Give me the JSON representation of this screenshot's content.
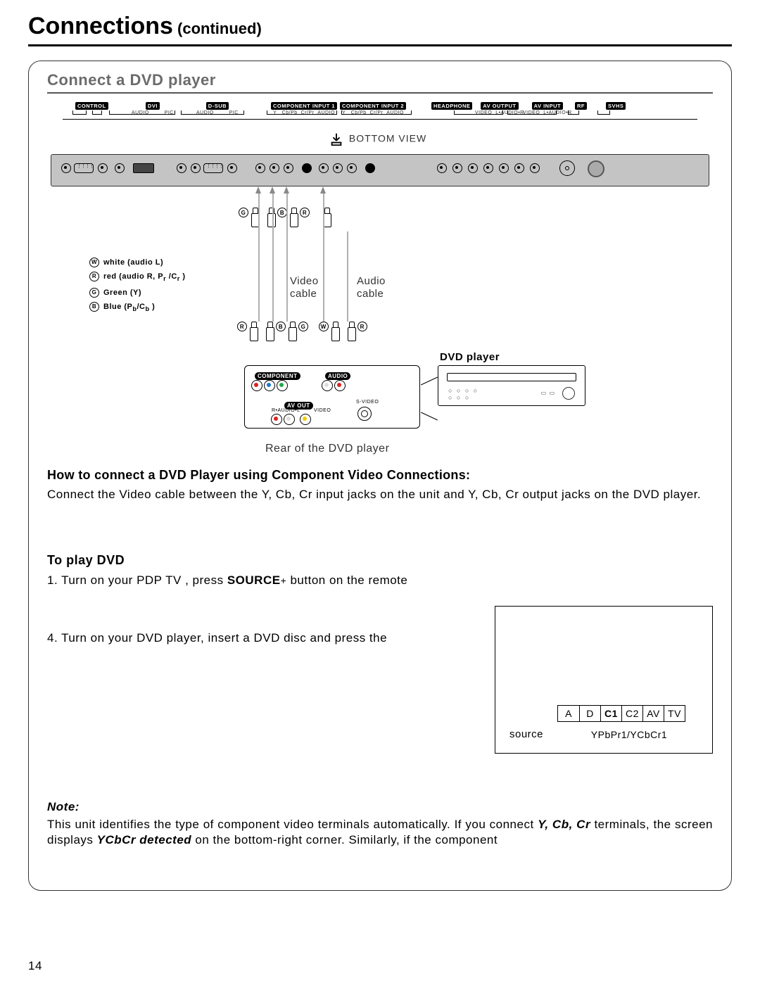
{
  "header": {
    "title": "Connections",
    "continued": " (continued)"
  },
  "section": {
    "title": "Connect a DVD player"
  },
  "diagram": {
    "bottom_view": "BOTTOM VIEW",
    "top_labels": {
      "control": "CONTROL",
      "dvi": "DVI",
      "dsub": "D-SUB",
      "comp1": "COMPONENT INPUT 1",
      "comp2": "COMPONENT INPUT 2",
      "headphone": "HEADPHONE",
      "avout": "AV OUTPUT",
      "avin": "AV INPUT",
      "rf": "RF",
      "svhs": "SVHS",
      "sub_audio": "AUDIO",
      "sub_pic": "PIC",
      "sub_y": "Y",
      "sub_cb": "Cb/Pb",
      "sub_cr": "Cr/Pr",
      "sub_video": "VIDEO",
      "sub_laudior": "L•AUDIO•R"
    },
    "cable_legend": {
      "w": "white (audio L)",
      "r_label": "red (audio R, P",
      "r_sub": "r",
      "r_tail": " /C",
      "r_sub2": "r",
      "r_close": " )",
      "g": "Green (Y)",
      "b_label": "Blue (P",
      "b_sub": "b",
      "b_mid": "/C",
      "b_sub2": "b",
      "b_close": " )"
    },
    "video_cable": "Video\ncable",
    "audio_cable": "Audio\ncable",
    "dvd_player": "DVD player",
    "rear_label": "Rear of the DVD player",
    "rear_labels": {
      "component": "COMPONENT",
      "audio": "AUDIO",
      "avout": "AV OUT",
      "r_audio_l": "R•AUDIO•L",
      "video": "VIDEO",
      "svideo": "S-VIDEO"
    }
  },
  "howto": {
    "title": "How to connect a DVD Player using Component Video Connections:",
    "text": "Connect the Video cable between the Y, Cb, Cr input jacks on the unit and Y, Cb, Cr output jacks on the DVD player."
  },
  "play": {
    "title": "To play DVD",
    "step1_a": "1. Turn on your PDP TV , press ",
    "step1_b": "SOURCE",
    "step1_sym": "+",
    "step1_c": "     button on the remote",
    "step4": "4. Turn on your DVD player, insert a DVD disc and press the"
  },
  "osd": {
    "source": "source",
    "cells": [
      "A",
      "D",
      "C1",
      "C2",
      "AV",
      "TV"
    ],
    "selected_index": 2,
    "signal": "YPbPr1/YCbCr1"
  },
  "note": {
    "title": "Note:",
    "seg1": "This unit identifies the type of component video terminals automatically. If you connect ",
    "bi1": "Y, Cb, Cr",
    "seg2": " terminals, the screen displays ",
    "bi2": "YCbCr detected",
    "seg3": "  on the bottom-right corner. Similarly, if the component"
  },
  "page_number": "14"
}
